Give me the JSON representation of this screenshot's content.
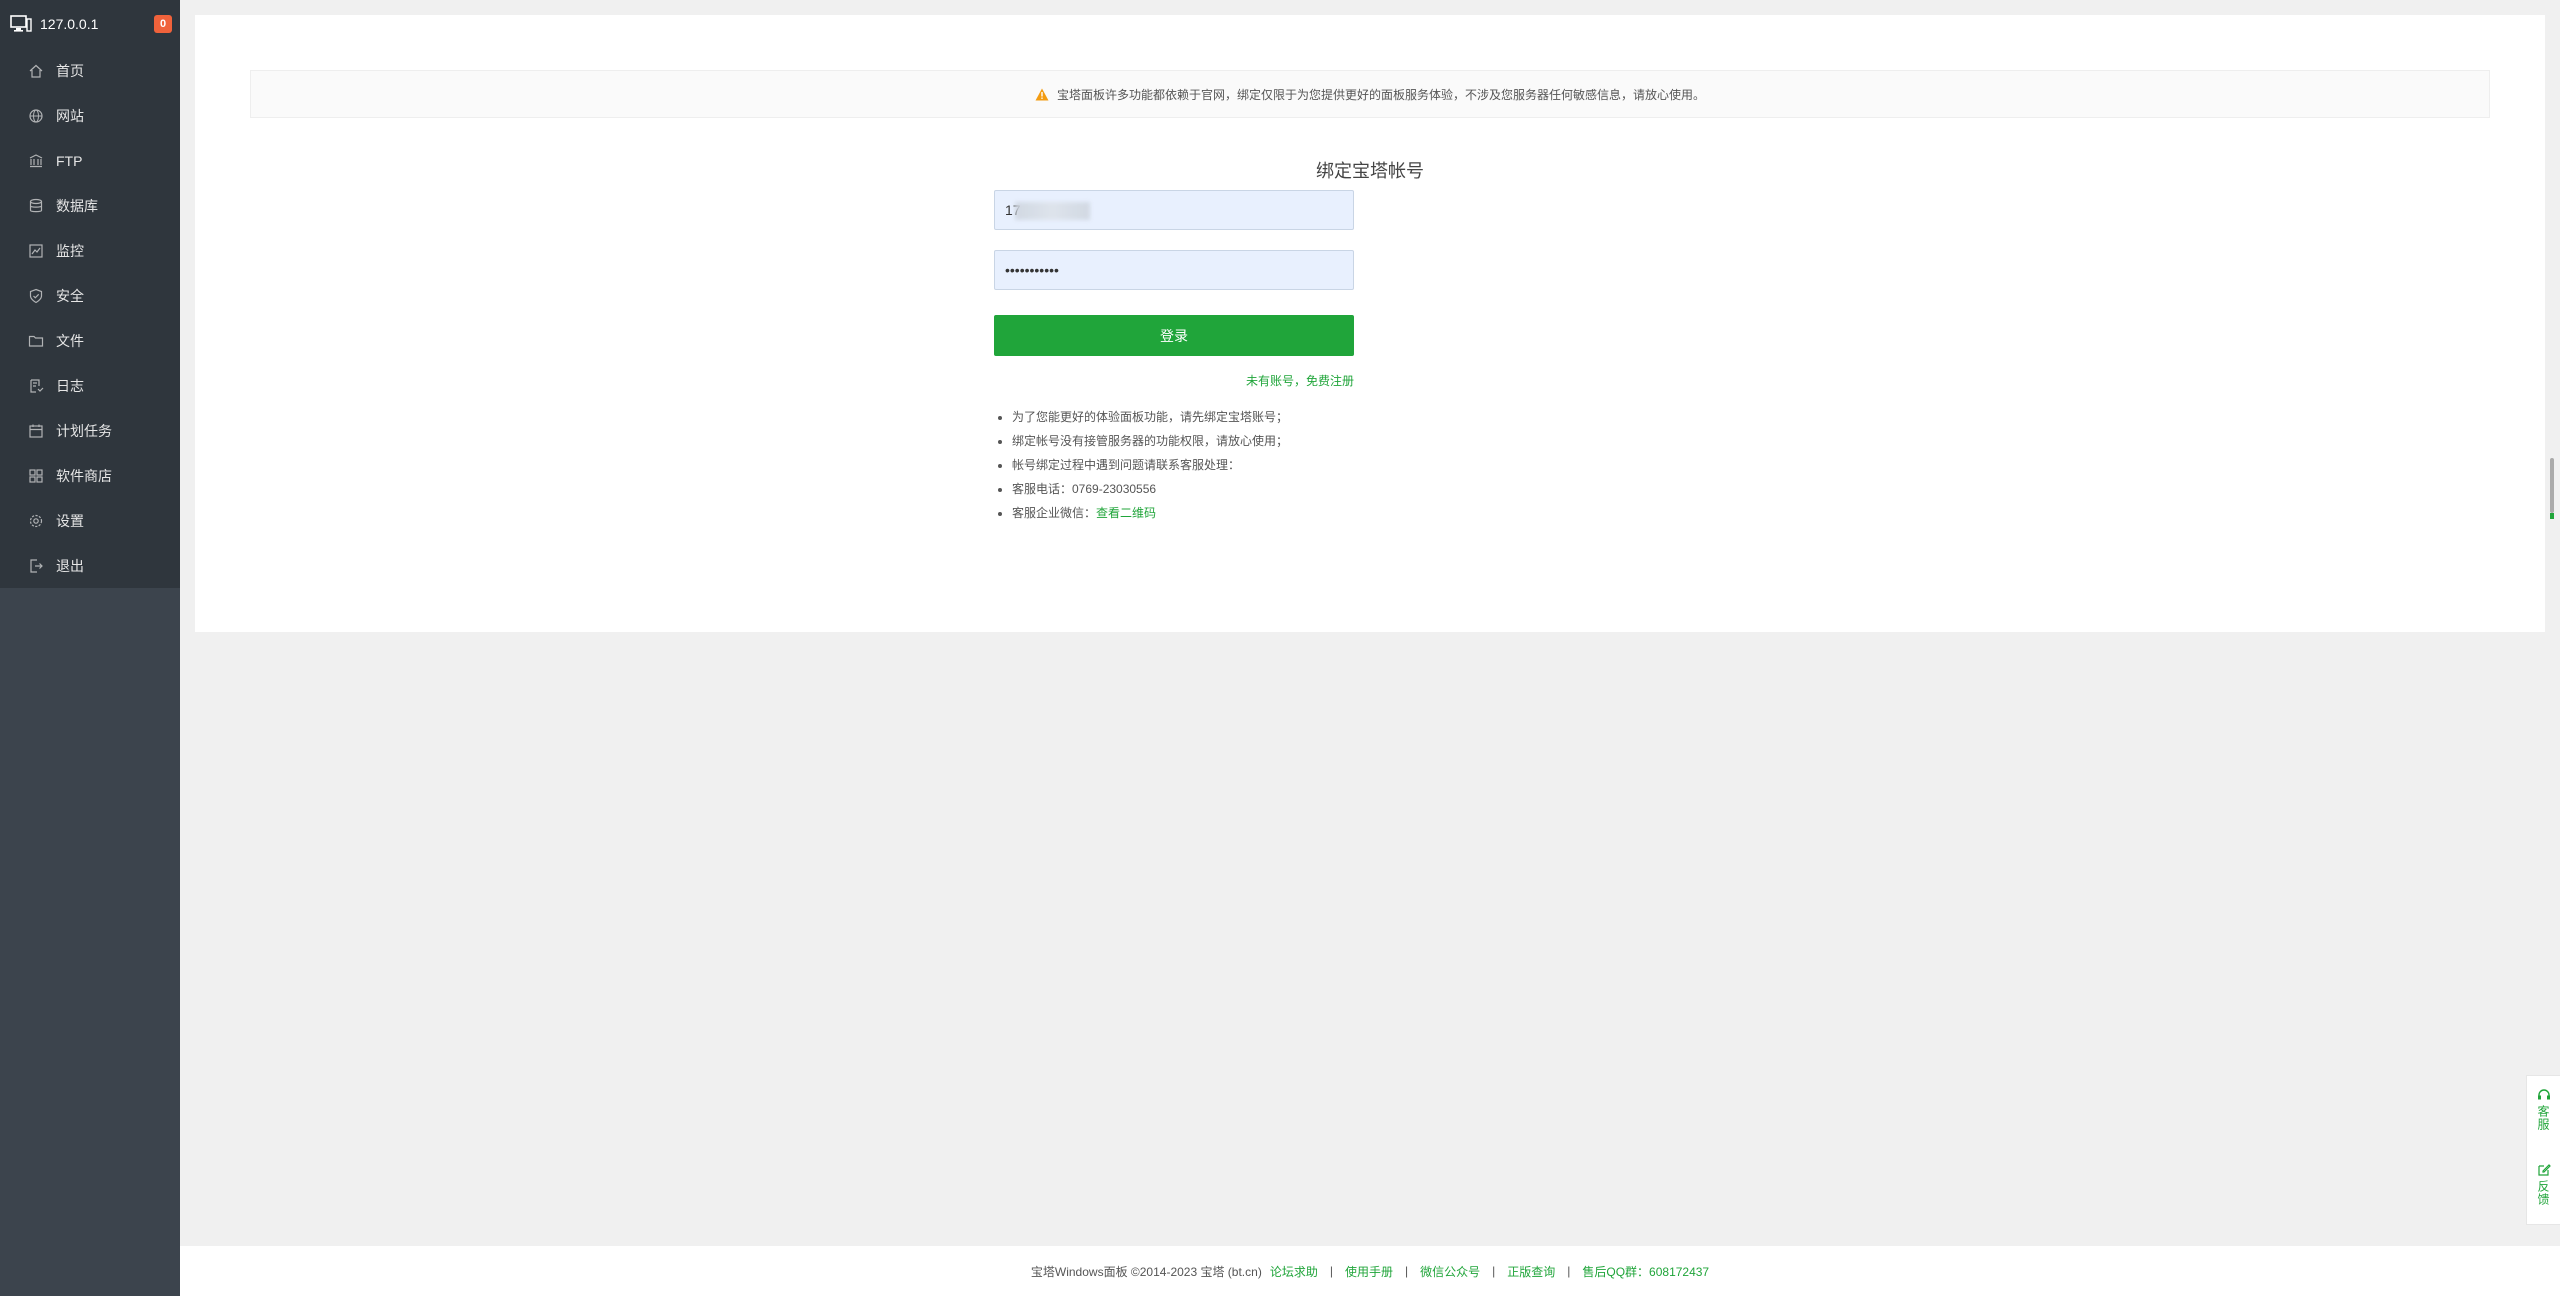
{
  "sidebar": {
    "server_name": "127.0.0.1",
    "badge_count": "0",
    "items": [
      {
        "label": "首页",
        "icon": "home-icon"
      },
      {
        "label": "网站",
        "icon": "globe-icon"
      },
      {
        "label": "FTP",
        "icon": "ftp-icon"
      },
      {
        "label": "数据库",
        "icon": "database-icon"
      },
      {
        "label": "监控",
        "icon": "monitor-icon"
      },
      {
        "label": "安全",
        "icon": "shield-icon"
      },
      {
        "label": "文件",
        "icon": "folder-icon"
      },
      {
        "label": "日志",
        "icon": "log-icon"
      },
      {
        "label": "计划任务",
        "icon": "calendar-icon"
      },
      {
        "label": "软件商店",
        "icon": "grid-icon"
      },
      {
        "label": "设置",
        "icon": "gear-icon"
      },
      {
        "label": "退出",
        "icon": "logout-icon"
      }
    ]
  },
  "notice": {
    "text": "宝塔面板许多功能都依赖于官网，绑定仅限于为您提供更好的面板服务体验，不涉及您服务器任何敏感信息，请放心使用。"
  },
  "bind_form": {
    "title": "绑定宝塔帐号",
    "username_value": "17",
    "password_value": "•••••••••••",
    "login_label": "登录",
    "register_link": "未有账号，免费注册",
    "tips": [
      "为了您能更好的体验面板功能，请先绑定宝塔账号；",
      "绑定帐号没有接管服务器的功能权限，请放心使用；",
      "帐号绑定过程中遇到问题请联系客服处理：",
      "客服电话：0769-23030556",
      "客服企业微信："
    ],
    "qr_link": "查看二维码"
  },
  "footer": {
    "copyright": "宝塔Windows面板 ©2014-2023 宝塔 (bt.cn)",
    "links": [
      "论坛求助",
      "使用手册",
      "微信公众号",
      "正版查询",
      "售后QQ群：608172437"
    ]
  },
  "float": {
    "service": "客服",
    "feedback": "反馈"
  },
  "colors": {
    "sidebar_bg": "#3c444d",
    "accent_green": "#20a53a",
    "badge_orange": "#f0623b"
  }
}
